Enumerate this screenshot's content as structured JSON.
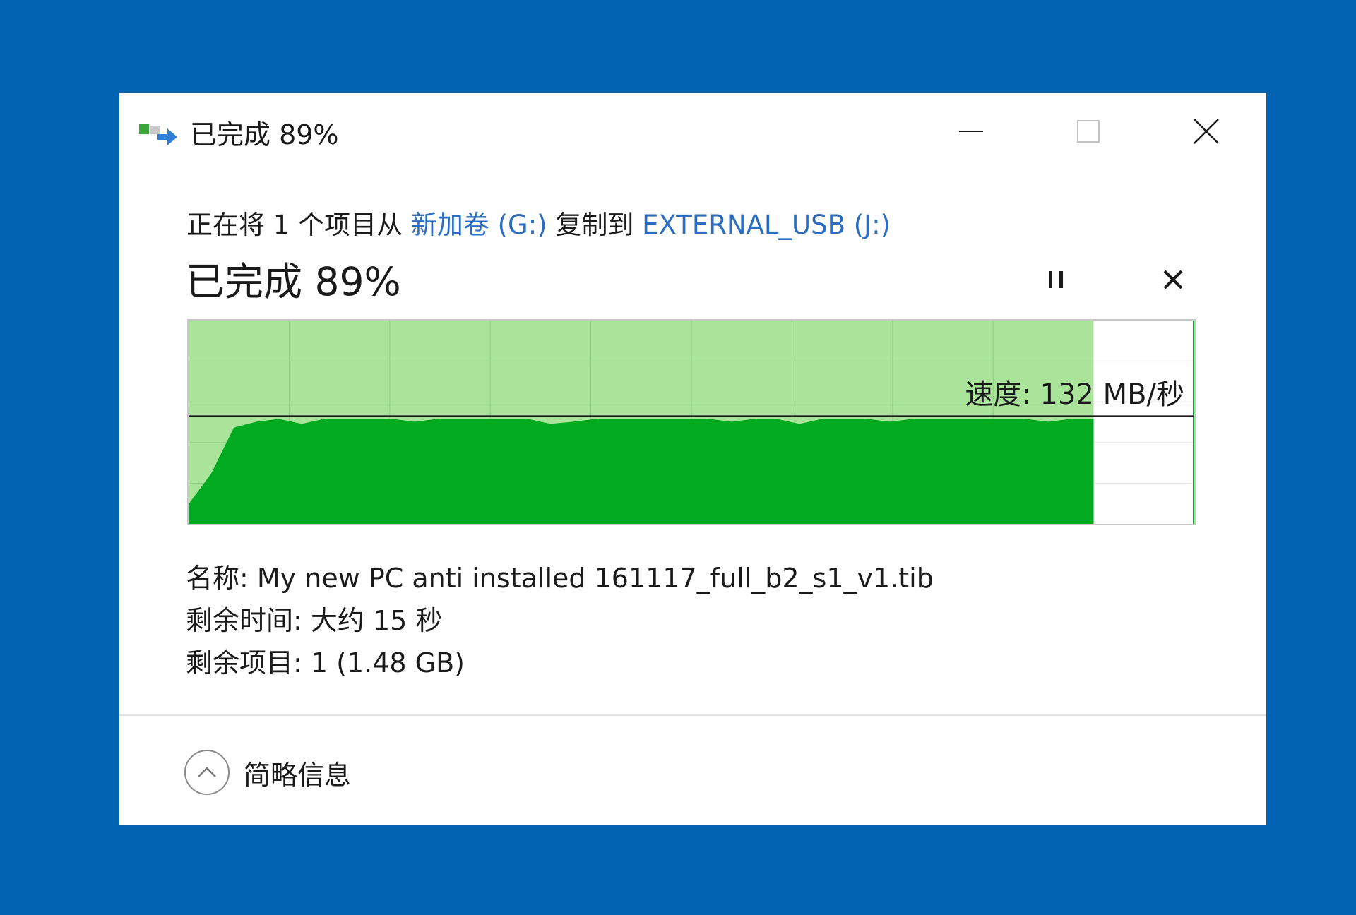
{
  "window": {
    "title": "已完成 89%"
  },
  "copy": {
    "prefix": "正在将 1 个项目从 ",
    "source": "新加卷 (G:)",
    "middle": " 复制到 ",
    "destination": "EXTERNAL_USB (J:)",
    "percent_label": "已完成 89%",
    "progress_fraction": 0.89
  },
  "graph": {
    "speed_label": "速度: 132 MB/秒",
    "speed_line_fraction": 0.53,
    "colors": {
      "fill_dark": "#00ab22",
      "fill_light": "#a9e49a",
      "grid": "#8fcf86",
      "border": "#c8c8c8"
    }
  },
  "details": {
    "name": "名称: My new PC anti installed 161117_full_b2_s1_v1.tib",
    "time_remaining": "剩余时间: 大约 15 秒",
    "items_remaining": "剩余项目: 1 (1.48 GB)"
  },
  "footer": {
    "toggle_label": "简略信息"
  },
  "icons": {
    "app": "copy-transfer-icon",
    "minimize": "minimize-icon",
    "maximize": "maximize-icon",
    "close": "close-icon",
    "pause": "pause-icon",
    "cancel": "cancel-icon",
    "toggle": "chevron-up-icon"
  }
}
